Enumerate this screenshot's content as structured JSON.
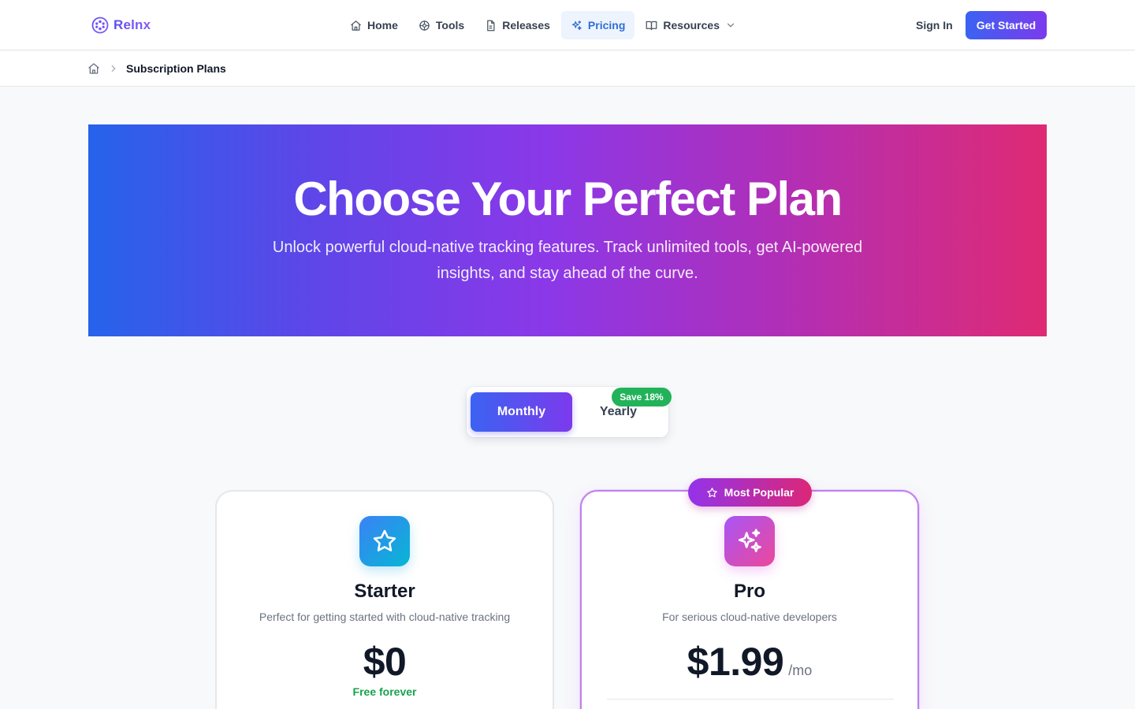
{
  "header": {
    "logo_text": "Relnx",
    "nav": [
      {
        "label": "Home",
        "icon": "home-icon"
      },
      {
        "label": "Tools",
        "icon": "tools-icon"
      },
      {
        "label": "Releases",
        "icon": "document-icon"
      },
      {
        "label": "Pricing",
        "icon": "sparkles-icon",
        "active": true
      },
      {
        "label": "Resources",
        "icon": "book-icon",
        "dropdown": true
      }
    ],
    "sign_in": "Sign In",
    "get_started": "Get Started"
  },
  "breadcrumb": {
    "current": "Subscription Plans"
  },
  "hero": {
    "title": "Choose Your Perfect Plan",
    "subtitle": "Unlock powerful cloud-native tracking features. Track unlimited tools, get AI-powered insights, and stay ahead of the curve."
  },
  "billing_toggle": {
    "monthly": "Monthly",
    "yearly": "Yearly",
    "save_badge": "Save 18%",
    "selected": "Monthly"
  },
  "plans": [
    {
      "name": "Starter",
      "icon": "star-icon",
      "description": "Perfect for getting started with cloud-native tracking",
      "price": "$0",
      "note": "Free forever"
    },
    {
      "name": "Pro",
      "icon": "sparkles-icon",
      "badge": "Most Popular",
      "description": "For serious cloud-native developers",
      "price": "$1.99",
      "period": "/mo"
    }
  ],
  "colors": {
    "accent_blue": "#3b63f2",
    "accent_purple": "#7c3aed",
    "accent_pink": "#db2777",
    "success_green": "#22b35a"
  }
}
